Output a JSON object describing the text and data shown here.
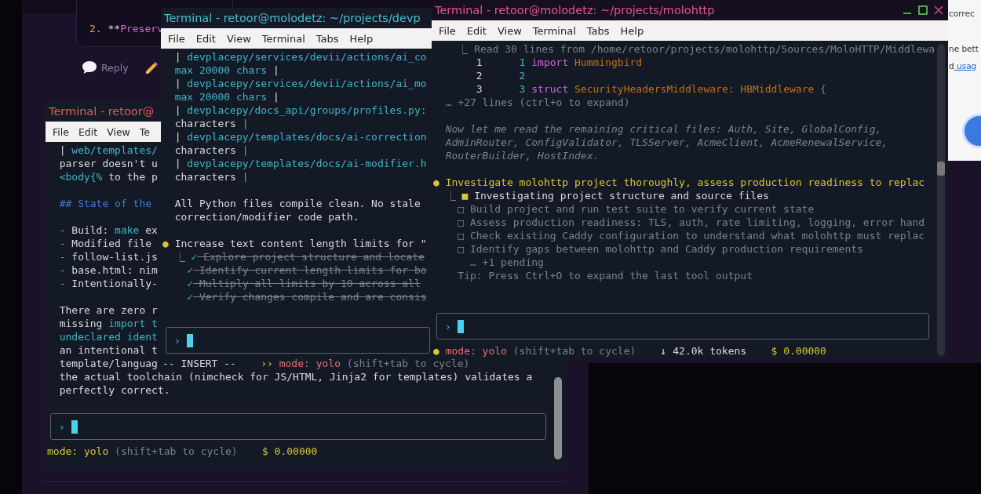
{
  "page_behind": {
    "list_item": [
      {
        "text": "2.",
        "kind": "num"
      },
      {
        "text": " **",
        "kind": "text"
      },
      {
        "text": "Preserv",
        "kind": "pink"
      }
    ],
    "reply_label": "Reply",
    "side_lines": [
      [
        {
          "text": "correc",
          "kind": "plain"
        }
      ],
      [
        {
          "text": "ne bett",
          "kind": "plain"
        }
      ],
      [
        {
          "text": "d",
          "kind": "plain"
        },
        {
          "text": " usag",
          "kind": "link"
        }
      ]
    ]
  },
  "windows": [
    {
      "title": "Terminal - retoor@",
      "color": "#e05a5a",
      "focused": false,
      "menu": [
        "File",
        "Edit",
        "View",
        "Te"
      ],
      "lines": [
        {
          "segs": [
            {
              "text": "  |",
              "kind": "text"
            },
            {
              "text": " web/templates/",
              "kind": "path"
            }
          ]
        },
        {
          "segs": [
            {
              "text": "  parser doesn't u",
              "kind": "text"
            }
          ]
        },
        {
          "segs": [
            {
              "text": "  <body{%",
              "kind": "path"
            },
            {
              "text": " to the p",
              "kind": "text"
            }
          ]
        },
        {
          "blank_before": true,
          "segs": [
            {
              "text": "  ## State of the",
              "kind": "heading"
            }
          ]
        },
        {
          "blank_before": true,
          "segs": [
            {
              "text": "  -",
              "kind": "path"
            },
            {
              "text": " Build:",
              "kind": "text"
            },
            {
              "text": " make",
              "kind": "path"
            },
            {
              "text": " ex",
              "kind": "text"
            }
          ]
        },
        {
          "segs": [
            {
              "text": "  -",
              "kind": "path"
            },
            {
              "text": " Modified file",
              "kind": "text"
            }
          ]
        },
        {
          "segs": [
            {
              "text": "  -",
              "kind": "path"
            },
            {
              "text": " follow-list.js",
              "kind": "text"
            }
          ]
        },
        {
          "segs": [
            {
              "text": "  -",
              "kind": "path"
            },
            {
              "text": " base.html: nim",
              "kind": "text"
            }
          ]
        },
        {
          "segs": [
            {
              "text": "  -",
              "kind": "path"
            },
            {
              "text": " Intentionally-",
              "kind": "text"
            }
          ]
        },
        {
          "blank_before": true,
          "segs": [
            {
              "text": "  There are zero r",
              "kind": "text"
            }
          ]
        },
        {
          "segs": [
            {
              "text": "  missing",
              "kind": "text"
            },
            {
              "text": " import t",
              "kind": "path"
            }
          ]
        },
        {
          "segs": [
            {
              "text": "  undeclared ident",
              "kind": "path"
            }
          ]
        },
        {
          "segs": [
            {
              "text": "  an intentional t",
              "kind": "text"
            }
          ]
        },
        {
          "segs": [
            {
              "text": "  template/languag",
              "kind": "text"
            }
          ]
        },
        {
          "segs": [
            {
              "text": "  the actual toolchain (nimcheck for JS/HTML, Jinja2 for templates) validates a",
              "kind": "text"
            }
          ]
        },
        {
          "segs": [
            {
              "text": "  perfectly correct.",
              "kind": "text"
            }
          ]
        }
      ],
      "input": {
        "prompt": "›"
      },
      "status": [
        {
          "text": "mode: yolo",
          "kind": "yellow"
        },
        {
          "text": " (shift+tab to cycle)",
          "kind": "dim"
        },
        {
          "text": "    $ 0.00000",
          "kind": "yellow"
        }
      ]
    },
    {
      "title": "Terminal - retoor@molodetz: ~/projects/devp",
      "color": "#4fb8d0",
      "focused": false,
      "menu": [
        "File",
        "Edit",
        "View",
        "Terminal",
        "Tabs",
        "Help"
      ],
      "lines": [
        {
          "segs": [
            {
              "text": "  |",
              "kind": "text"
            },
            {
              "text": " devplacepy/services/devii/actions/ai_co",
              "kind": "path"
            }
          ]
        },
        {
          "segs": [
            {
              "text": "  max 20000 chars",
              "kind": "path"
            },
            {
              "text": " |",
              "kind": "text"
            }
          ]
        },
        {
          "segs": [
            {
              "text": "  |",
              "kind": "text"
            },
            {
              "text": " devplacepy/services/devii/actions/ai_mo",
              "kind": "path"
            }
          ]
        },
        {
          "segs": [
            {
              "text": "  max 20000 chars",
              "kind": "path"
            },
            {
              "text": " |",
              "kind": "text"
            }
          ]
        },
        {
          "segs": [
            {
              "text": "  |",
              "kind": "text"
            },
            {
              "text": " devplacepy/docs_api/groups/profiles.py:",
              "kind": "path"
            }
          ]
        },
        {
          "segs": [
            {
              "text": "  characters",
              "kind": "text"
            },
            {
              "text": " |",
              "kind": "path"
            }
          ]
        },
        {
          "segs": [
            {
              "text": "  |",
              "kind": "text"
            },
            {
              "text": " devplacepy/templates/docs/ai-correction",
              "kind": "path"
            }
          ]
        },
        {
          "segs": [
            {
              "text": "  characters",
              "kind": "text"
            },
            {
              "text": " |",
              "kind": "path"
            }
          ]
        },
        {
          "segs": [
            {
              "text": "  |",
              "kind": "text"
            },
            {
              "text": " devplacepy/templates/docs/ai-modifier.h",
              "kind": "path"
            }
          ]
        },
        {
          "segs": [
            {
              "text": "  characters",
              "kind": "text"
            },
            {
              "text": " |",
              "kind": "path"
            }
          ]
        },
        {
          "blank_before": true,
          "segs": [
            {
              "text": "  All Python files compile clean. No stale",
              "kind": "text"
            }
          ]
        },
        {
          "segs": [
            {
              "text": "  correction/modifier code path.",
              "kind": "text"
            }
          ]
        },
        {
          "blank_before": true,
          "segs": [
            {
              "text": "●",
              "kind": "yellow"
            },
            {
              "text": " Increase text content length limits for \"",
              "kind": "text"
            }
          ]
        },
        {
          "segs": [
            {
              "text": "  ⎿",
              "kind": "dim"
            },
            {
              "text": " ✓",
              "kind": "check"
            },
            {
              "text": " Explore project structure and locate",
              "kind": "done"
            }
          ]
        },
        {
          "segs": [
            {
              "text": "    ✓",
              "kind": "check"
            },
            {
              "text": " Identify current length limits for bo",
              "kind": "done"
            }
          ]
        },
        {
          "segs": [
            {
              "text": "    ✓",
              "kind": "check"
            },
            {
              "text": " Multiply all limits by 10 across all",
              "kind": "done"
            }
          ]
        },
        {
          "segs": [
            {
              "text": "    ✓",
              "kind": "check"
            },
            {
              "text": " Verify changes compile and are consis",
              "kind": "done"
            }
          ]
        }
      ],
      "input": {
        "prompt": "›"
      },
      "status": [
        {
          "text": "-- INSERT --",
          "kind": "text"
        },
        {
          "text": "    ››",
          "kind": "yellow"
        },
        {
          "text": " mode: yolo",
          "kind": "red"
        },
        {
          "text": " (shift+tab to cycle)",
          "kind": "dim"
        }
      ]
    },
    {
      "title": "Terminal - retoor@molodetz: ~/projects/molohttp",
      "color": "#e0559a",
      "focused": true,
      "menu": [
        "File",
        "Edit",
        "View",
        "Terminal",
        "Tabs",
        "Help"
      ],
      "lines": [
        {
          "segs": [
            {
              "text": "    ⎿ Read 30 lines from /home/retoor/projects/molohttp/Sources/MoloHTTP/Middlewa",
              "kind": "dim"
            }
          ]
        },
        {
          "segs": [
            {
              "text": "       1",
              "kind": "text"
            },
            {
              "text": "      1",
              "kind": "path"
            },
            {
              "text": " import",
              "kind": "keyword"
            },
            {
              "text": " Hummingbird",
              "kind": "type"
            }
          ]
        },
        {
          "segs": [
            {
              "text": "       2",
              "kind": "text"
            },
            {
              "text": "      2",
              "kind": "path"
            }
          ]
        },
        {
          "segs": [
            {
              "text": "       3",
              "kind": "text"
            },
            {
              "text": "      3",
              "kind": "path"
            },
            {
              "text": " struct",
              "kind": "keyword"
            },
            {
              "text": " SecurityHeadersMiddleware",
              "kind": "type"
            },
            {
              "text": ":",
              "kind": "dim"
            },
            {
              "text": " HBMiddleware",
              "kind": "type"
            },
            {
              "text": " {",
              "kind": "dim"
            }
          ]
        },
        {
          "segs": [
            {
              "text": "  … +27 lines (ctrl+o to expand)",
              "kind": "dim"
            }
          ]
        },
        {
          "blank_before": true,
          "segs": [
            {
              "text": "  Now let me read the remaining critical files: Auth, Site, GlobalConfig,",
              "kind": "italic"
            }
          ]
        },
        {
          "segs": [
            {
              "text": "  AdminRouter, ConfigValidator, TLSServer, AcmeClient, AcmeRenewalService,",
              "kind": "italic"
            }
          ]
        },
        {
          "segs": [
            {
              "text": "  RouterBuilder, HostIndex.",
              "kind": "italic"
            }
          ]
        },
        {
          "blank_before": true,
          "segs": [
            {
              "text": "● Investigate molohttp project thoroughly, assess production readiness to replac",
              "kind": "yellow"
            }
          ]
        },
        {
          "segs": [
            {
              "text": "  ⎿",
              "kind": "dim"
            },
            {
              "text": " ■",
              "kind": "yellow"
            },
            {
              "text": " Investigating project structure and source files",
              "kind": "text"
            }
          ]
        },
        {
          "segs": [
            {
              "text": "    □ Build project and run test suite to verify current state",
              "kind": "dim"
            }
          ]
        },
        {
          "segs": [
            {
              "text": "    □ Assess production readiness: TLS, auth, rate limiting, logging, error hand",
              "kind": "dim"
            }
          ]
        },
        {
          "segs": [
            {
              "text": "    □ Check existing Caddy configuration to understand what molohttp must replac",
              "kind": "dim"
            }
          ]
        },
        {
          "segs": [
            {
              "text": "    □ Identify gaps between molohttp and Caddy production requirements",
              "kind": "dim"
            }
          ]
        },
        {
          "segs": [
            {
              "text": "      … +1 pending",
              "kind": "dim"
            }
          ]
        },
        {
          "segs": [
            {
              "text": "    Tip: Press Ctrl+O to expand the last tool output",
              "kind": "dim"
            }
          ]
        }
      ],
      "input": {
        "prompt": "›"
      },
      "status": [
        {
          "text": "●",
          "kind": "yellow"
        },
        {
          "text": " mode: yolo",
          "kind": "red"
        },
        {
          "text": " (shift+tab to cycle)",
          "kind": "dim"
        },
        {
          "text": "    ↓ 42.0k tokens",
          "kind": "text"
        },
        {
          "text": "    $ 0.00000",
          "kind": "yellow"
        }
      ]
    }
  ]
}
